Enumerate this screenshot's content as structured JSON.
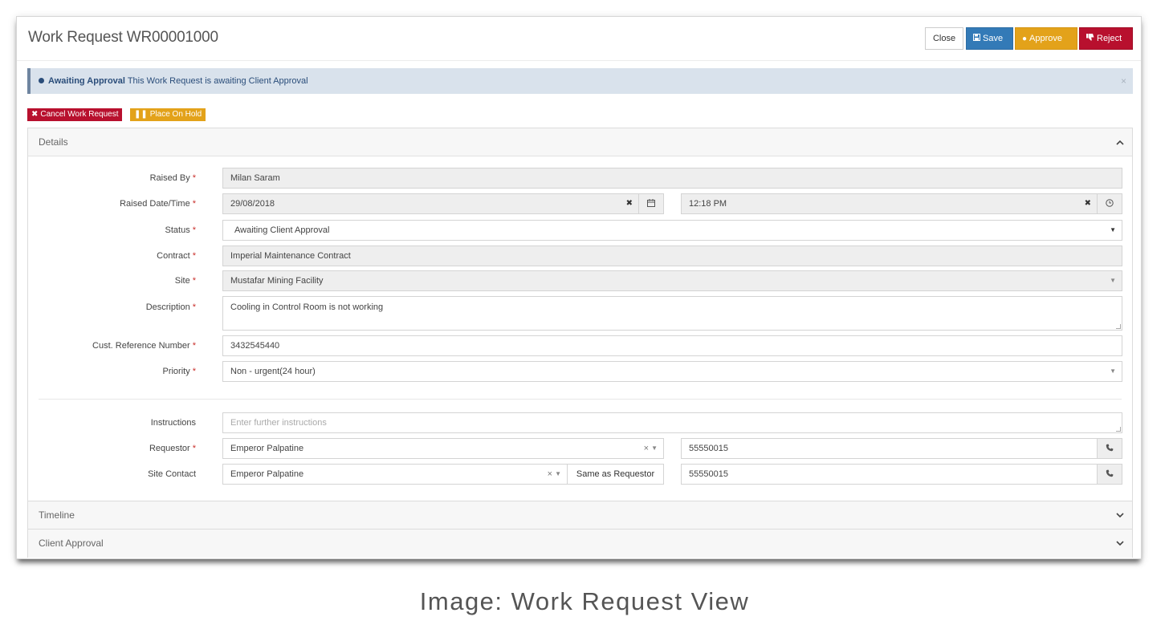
{
  "header": {
    "title": "Work Request WR00001000",
    "close_label": "Close",
    "save_label": "Save",
    "approve_label": "Approve",
    "reject_label": "Reject"
  },
  "alert": {
    "status": "Awaiting Approval",
    "message": "This Work Request is awaiting Client Approval",
    "close_glyph": "×"
  },
  "actions": {
    "cancel_label": "Cancel Work Request",
    "hold_label": "Place On Hold"
  },
  "details": {
    "heading": "Details",
    "raised_by": {
      "label": "Raised By",
      "value": "Milan Saram"
    },
    "raised_datetime": {
      "label": "Raised Date/Time",
      "date": "29/08/2018",
      "time": "12:18 PM"
    },
    "status": {
      "label": "Status",
      "value": "Awaiting Client Approval"
    },
    "contract": {
      "label": "Contract",
      "value": "Imperial Maintenance Contract"
    },
    "site": {
      "label": "Site",
      "value": "Mustafar Mining Facility"
    },
    "description": {
      "label": "Description",
      "value": "Cooling in Control Room is not working"
    },
    "cust_ref": {
      "label": "Cust. Reference Number",
      "value": "3432545440"
    },
    "priority": {
      "label": "Priority",
      "value": "Non - urgent(24 hour)"
    },
    "instructions": {
      "label": "Instructions",
      "placeholder": "Enter further instructions"
    },
    "requestor": {
      "label": "Requestor",
      "value": "Emperor Palpatine",
      "phone": "55550015"
    },
    "site_contact": {
      "label": "Site Contact",
      "value": "Emperor Palpatine",
      "same_label": "Same as Requestor",
      "phone": "55550015"
    },
    "required_mark": "*"
  },
  "sections": {
    "timeline": "Timeline",
    "client_approval": "Client Approval"
  },
  "caption": "Image: Work Request View",
  "colors": {
    "save": "#337ab7",
    "approve": "#e3a21a",
    "reject": "#b8102e",
    "alert_bg": "#d9e2ec",
    "required": "#c9302c"
  },
  "icons": [
    "save-icon",
    "circle-icon",
    "thumbs-down-icon",
    "times-icon",
    "pause-icon",
    "chevron-up-icon",
    "chevron-down-icon",
    "calendar-icon",
    "clock-icon",
    "phone-icon",
    "caret-down-icon"
  ]
}
